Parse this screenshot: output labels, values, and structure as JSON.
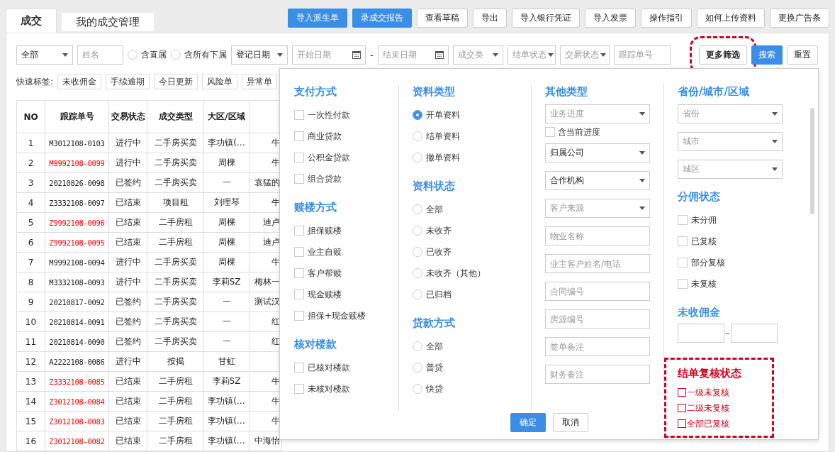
{
  "tabs": [
    {
      "label": "成交",
      "selected": true
    },
    {
      "label": "我的成交管理",
      "selected": false
    }
  ],
  "toolbar_buttons": [
    {
      "label": "导入派生单",
      "primary": true
    },
    {
      "label": "录成交报告",
      "primary": true
    },
    {
      "label": "查看草稿",
      "primary": false
    },
    {
      "label": "导出",
      "primary": false
    },
    {
      "label": "导入银行凭证",
      "primary": false
    },
    {
      "label": "导入发票",
      "primary": false
    },
    {
      "label": "操作指引",
      "primary": false
    },
    {
      "label": "如何上传资料",
      "primary": false
    },
    {
      "label": "更换广告条",
      "primary": false
    }
  ],
  "filters": [
    {
      "kind": "select",
      "value": "全部"
    },
    {
      "kind": "input",
      "placeholder": "姓名"
    },
    {
      "kind": "radio",
      "label": "含直属",
      "selected": false
    },
    {
      "kind": "radio",
      "label": "含所有下属",
      "selected": false
    },
    {
      "kind": "select",
      "value": "登记日期"
    },
    {
      "kind": "date",
      "placeholder": "开始日期"
    },
    {
      "kind": "dash",
      "label": "-"
    },
    {
      "kind": "date",
      "placeholder": "结束日期"
    },
    {
      "kind": "select",
      "placeholder": "成交类"
    },
    {
      "kind": "dropdown",
      "placeholder": "结单状态"
    },
    {
      "kind": "dropdown",
      "placeholder": "交易状态"
    },
    {
      "kind": "input",
      "placeholder": "跟踪单号"
    }
  ],
  "filter_buttons": [
    {
      "label": "更多筛选",
      "kind": "outline",
      "annotated": true
    },
    {
      "label": "搜索",
      "kind": "primary",
      "annotated": false
    },
    {
      "label": "重置",
      "kind": "outline",
      "annotated": false
    }
  ],
  "quick_tags": {
    "label": "快速标签:",
    "items": [
      "未收佣金",
      "手续逾期",
      "今日更新",
      "风险单",
      "异常单"
    ]
  },
  "table": {
    "columns": [
      "NO",
      "跟踪单号",
      "交易状态",
      "成交类型",
      "大区/区域"
    ],
    "rows": [
      {
        "no": "1",
        "tracking_no": "M3012108-0103",
        "flagged": false,
        "status": "进行中",
        "type": "二手房买卖",
        "region": "李功镇(…",
        "column_6": "牛"
      },
      {
        "no": "2",
        "tracking_no": "M9992108-0099",
        "flagged": true,
        "status": "进行中",
        "type": "二手房买卖",
        "region": "周棵",
        "column_6": "牛"
      },
      {
        "no": "3",
        "tracking_no": "20210826-0098",
        "flagged": false,
        "status": "已签约",
        "type": "二手房买卖",
        "region": "一",
        "column_6": "袁猛的"
      },
      {
        "no": "4",
        "tracking_no": "Z3332108-0097",
        "flagged": false,
        "status": "已结束",
        "type": "项目租",
        "region": "刘理琴",
        "column_6": "牛"
      },
      {
        "no": "5",
        "tracking_no": "Z9992108-0096",
        "flagged": true,
        "status": "已结束",
        "type": "二手房租",
        "region": "周棵",
        "column_6": "迪卢"
      },
      {
        "no": "6",
        "tracking_no": "Z9992108-0095",
        "flagged": true,
        "status": "已结束",
        "type": "二手房租",
        "region": "周棵",
        "column_6": "迪卢"
      },
      {
        "no": "7",
        "tracking_no": "M9992108-0094",
        "flagged": false,
        "status": "进行中",
        "type": "二手房买卖",
        "region": "周棵",
        "column_6": "牛"
      },
      {
        "no": "8",
        "tracking_no": "M3332108-0093",
        "flagged": false,
        "status": "进行中",
        "type": "二手房买卖",
        "region": "李莉SZ",
        "column_6": "梅林一"
      },
      {
        "no": "9",
        "tracking_no": "20210817-0092",
        "flagged": false,
        "status": "已签约",
        "type": "二手房买卖",
        "region": "一",
        "column_6": "测试汉"
      },
      {
        "no": "10",
        "tracking_no": "20210814-0091",
        "flagged": false,
        "status": "已签约",
        "type": "二手房买卖",
        "region": "一",
        "column_6": "红"
      },
      {
        "no": "11",
        "tracking_no": "20210814-0090",
        "flagged": false,
        "status": "已签约",
        "type": "二手房买卖",
        "region": "一",
        "column_6": "红"
      },
      {
        "no": "12",
        "tracking_no": "A2222108-0086",
        "flagged": false,
        "status": "进行中",
        "type": "按揭",
        "region": "甘虹"
      },
      {
        "no": "13",
        "tracking_no": "Z3332108-0085",
        "flagged": true,
        "status": "已结束",
        "type": "二手房租",
        "region": "李莉SZ",
        "column_6": "牛"
      },
      {
        "no": "14",
        "tracking_no": "Z3012108-0084",
        "flagged": true,
        "status": "已结束",
        "type": "二手房租",
        "region": "李功镇(…",
        "column_6": "牛"
      },
      {
        "no": "15",
        "tracking_no": "Z3012108-0083",
        "flagged": true,
        "status": "已结束",
        "type": "二手房租",
        "region": "李功镇(…",
        "column_6": "牛"
      },
      {
        "no": "16",
        "tracking_no": "Z3012108-0082",
        "flagged": true,
        "status": "已结束",
        "type": "二手房租",
        "region": "李功镇(…",
        "column_6": "中海怡"
      }
    ]
  },
  "more_filters": {
    "columns": [
      {
        "sections": [
          {
            "title": "支付方式",
            "kind": "checkbox",
            "annotated": false,
            "options": [
              {
                "label": "一次性付款",
                "checked": false
              },
              {
                "label": "商业贷款",
                "checked": false
              },
              {
                "label": "公积金贷款",
                "checked": false
              },
              {
                "label": "组合贷款",
                "checked": false
              }
            ]
          },
          {
            "title": "赎楼方式",
            "kind": "checkbox",
            "annotated": false,
            "options": [
              {
                "label": "担保赎楼",
                "checked": false
              },
              {
                "label": "业主自赎",
                "checked": false
              },
              {
                "label": "客户帮赎",
                "checked": false
              },
              {
                "label": "现金赎楼",
                "checked": false
              },
              {
                "label": "担保+现金赎楼",
                "checked": false
              }
            ]
          },
          {
            "title": "核对楼款",
            "kind": "checkbox",
            "annotated": false,
            "options": [
              {
                "label": "已核对楼款",
                "checked": false
              },
              {
                "label": "未核对楼款",
                "checked": false
              }
            ]
          }
        ]
      },
      {
        "sections": [
          {
            "title": "资料类型",
            "kind": "radio",
            "annotated": false,
            "options": [
              {
                "label": "开单资料",
                "selected": true
              },
              {
                "label": "结单资料",
                "selected": false
              },
              {
                "label": "撤单资料",
                "selected": false
              }
            ]
          },
          {
            "title": "资料状态",
            "kind": "radio",
            "annotated": false,
            "options": [
              {
                "label": "全部",
                "selected": false
              },
              {
                "label": "未收齐",
                "selected": false
              },
              {
                "label": "已收齐",
                "selected": false
              },
              {
                "label": "未收齐（其他）",
                "selected": false
              },
              {
                "label": "已归档",
                "selected": false
              }
            ]
          },
          {
            "title": "贷款方式",
            "kind": "radio",
            "annotated": false,
            "options": [
              {
                "label": "全部",
                "selected": false
              },
              {
                "label": "普贷",
                "selected": false
              },
              {
                "label": "快贷",
                "selected": false
              }
            ]
          }
        ]
      },
      {
        "sections": [
          {
            "title": "其他类型",
            "kind": "fields",
            "annotated": false,
            "fields": [
              {
                "kind": "select",
                "placeholder": "业务进度"
              },
              {
                "kind": "checkbox",
                "label": "含当前进度",
                "checked": false
              },
              {
                "kind": "select",
                "value": "归属公司"
              },
              {
                "kind": "select",
                "value": "合作机构"
              },
              {
                "kind": "select",
                "placeholder": "客户来源"
              },
              {
                "kind": "input",
                "placeholder": "物业名称"
              },
              {
                "kind": "input",
                "placeholder": "业主客户姓名/电话"
              },
              {
                "kind": "input",
                "placeholder": "合同编号"
              },
              {
                "kind": "input",
                "placeholder": "房源编号"
              },
              {
                "kind": "input",
                "placeholder": "签单备注"
              },
              {
                "kind": "input",
                "placeholder": "财务备注"
              }
            ]
          }
        ]
      },
      {
        "sections": [
          {
            "title": "省份/城市/区域",
            "kind": "fields",
            "annotated": false,
            "fields": [
              {
                "kind": "select",
                "placeholder": "省份"
              },
              {
                "kind": "select",
                "placeholder": "城市"
              },
              {
                "kind": "select",
                "placeholder": "城区"
              }
            ]
          },
          {
            "title": "分佣状态",
            "kind": "checkbox",
            "annotated": false,
            "options": [
              {
                "label": "未分佣",
                "checked": false
              },
              {
                "label": "已复核",
                "checked": false
              },
              {
                "label": "部分复核",
                "checked": false
              },
              {
                "label": "未复核",
                "checked": false
              }
            ]
          },
          {
            "title": "未收佣金",
            "kind": "range",
            "annotated": false,
            "separator": "–"
          },
          {
            "title": "结单复核状态",
            "kind": "checkbox",
            "annotated": true,
            "options": [
              {
                "label": "一级未复核",
                "checked": false
              },
              {
                "label": "二级未复核",
                "checked": false
              },
              {
                "label": "全部已复核",
                "checked": false
              }
            ]
          }
        ]
      }
    ],
    "buttons": [
      {
        "label": "确定",
        "primary": true
      },
      {
        "label": "取消",
        "primary": false
      }
    ]
  }
}
